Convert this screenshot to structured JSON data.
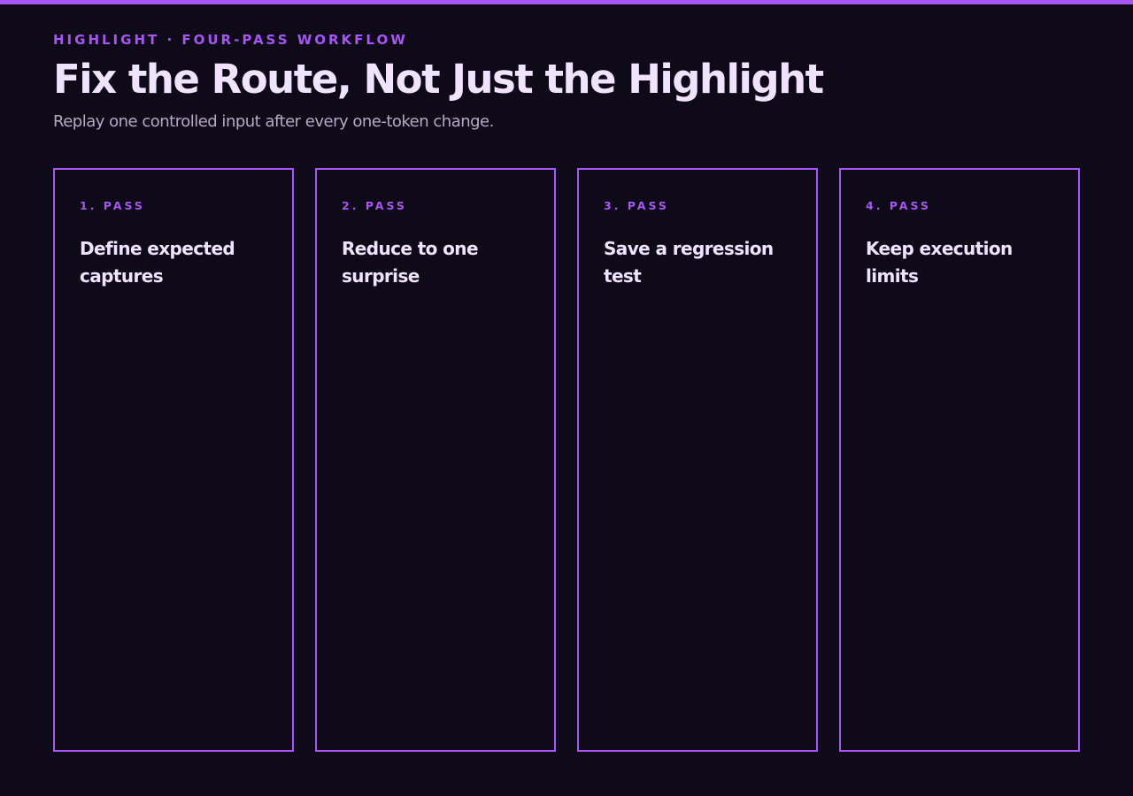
{
  "header": {
    "eyebrow": "HIGHLIGHT · FOUR-PASS WORKFLOW",
    "title": "Fix the Route, Not Just the Highlight",
    "subtitle": "Replay one controlled input after every one-token change."
  },
  "cards": [
    {
      "label": "1. PASS",
      "title": "Define expected captures"
    },
    {
      "label": "2. PASS",
      "title": "Reduce to one surprise"
    },
    {
      "label": "3. PASS",
      "title": "Save a regression test"
    },
    {
      "label": "4. PASS",
      "title": "Keep execution limits"
    }
  ],
  "colors": {
    "background": "#0e0a18",
    "accent": "#a855f7",
    "title_text": "#efe3ff",
    "muted_text": "#b5a9c6"
  }
}
